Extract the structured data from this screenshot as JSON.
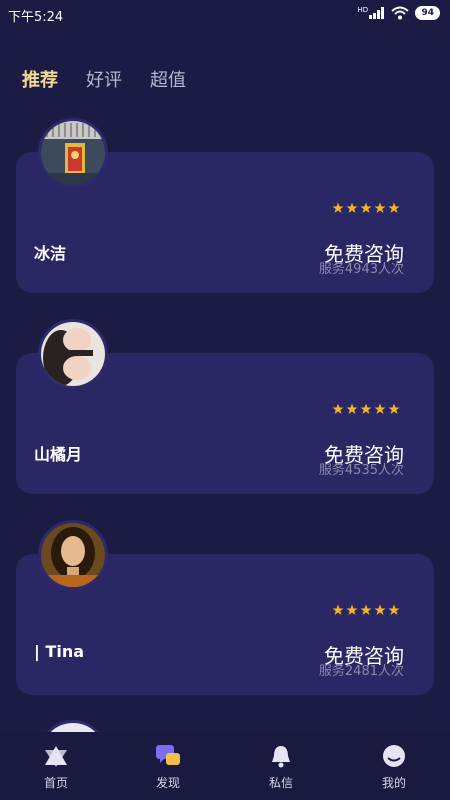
{
  "status_bar": {
    "time": "下午5:24",
    "network_badge": "HD",
    "battery": "94"
  },
  "tabs": [
    {
      "label": "推荐",
      "active": true
    },
    {
      "label": "好评",
      "active": false
    },
    {
      "label": "超值",
      "active": false
    }
  ],
  "advisors": [
    {
      "name": "冰洁",
      "action": "免费咨询",
      "served": "服务4943人次",
      "rating": 5,
      "avatar": "tarot-card-avatar"
    },
    {
      "name": "山橘月",
      "action": "免费咨询",
      "served": "服务4535人次",
      "rating": 5,
      "avatar": "portrait-avatar"
    },
    {
      "name": "| Tina",
      "action": "免费咨询",
      "served": "服务2481人次",
      "rating": 5,
      "avatar": "portrait-avatar"
    }
  ],
  "nav": [
    {
      "label": "首页",
      "icon": "triangle-star-icon"
    },
    {
      "label": "发现",
      "icon": "chat-bubbles-icon"
    },
    {
      "label": "私信",
      "icon": "bell-icon"
    },
    {
      "label": "我的",
      "icon": "profile-face-icon"
    }
  ],
  "colors": {
    "background": "#1c1b44",
    "card": "#292764",
    "active_tab": "#f5d893",
    "star": "#f5b423",
    "nav_accent": "#7b6cf0"
  }
}
